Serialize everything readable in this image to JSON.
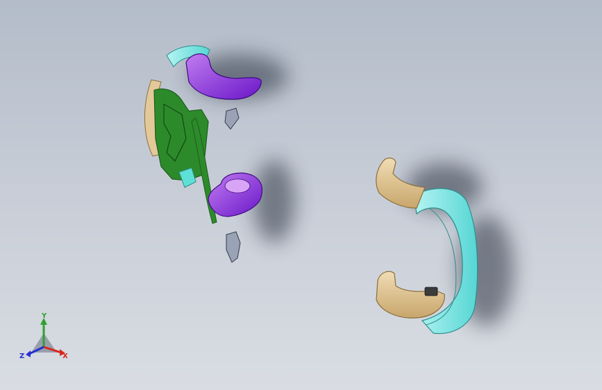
{
  "viewport": {
    "background_top": "#b3bcc9",
    "background_bottom": "#d9dde3"
  },
  "parts": {
    "left_assembly": {
      "colors": {
        "shell": "#7a1fd6",
        "shell_highlight": "#c07cf0",
        "frame": "#2c8a2a",
        "frame_dark": "#1e5e1c",
        "trim": "#5fe0d6",
        "base": "#e3c99a",
        "part": "#9aa3b5"
      }
    },
    "right_assembly": {
      "colors": {
        "housing": "#7ce8e6",
        "housing_edge": "#3aa8a6",
        "pad": "#e3c99a",
        "pad_edge": "#8a6e3c"
      }
    }
  },
  "triad": {
    "x_label": "X",
    "y_label": "Y",
    "z_label": "Z",
    "x_color": "#d6281e",
    "y_color": "#2fa12f",
    "z_color": "#2430d0"
  }
}
